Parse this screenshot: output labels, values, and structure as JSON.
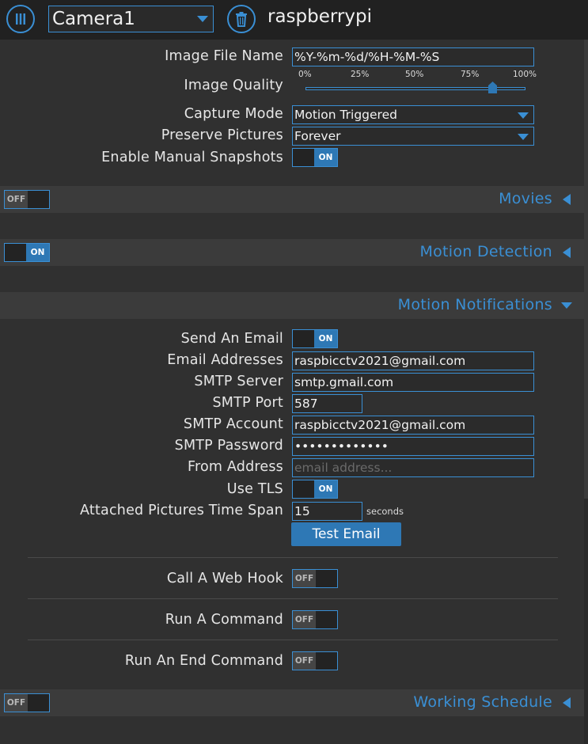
{
  "header": {
    "camera_select_value": "Camera1",
    "hostname": "raspberrypi",
    "menu_icon": "menu-bars-icon",
    "delete_icon": "trash-icon"
  },
  "still_images": {
    "image_file_name_label": "Image File Name",
    "image_file_name_value": "%Y-%m-%d/%H-%M-%S",
    "image_quality_label": "Image Quality",
    "image_quality_value_percent": 85,
    "slider_ticks": [
      "0%",
      "25%",
      "50%",
      "75%",
      "100%"
    ],
    "capture_mode_label": "Capture Mode",
    "capture_mode_value": "Motion Triggered",
    "preserve_pictures_label": "Preserve Pictures",
    "preserve_pictures_value": "Forever",
    "manual_snapshots_label": "Enable Manual Snapshots",
    "manual_snapshots_state": "ON"
  },
  "sections": {
    "movies": {
      "title": "Movies",
      "state": "OFF"
    },
    "motion_detection": {
      "title": "Motion Detection",
      "state": "ON"
    },
    "motion_notifications": {
      "title": "Motion Notifications"
    },
    "working_schedule": {
      "title": "Working Schedule",
      "state": "OFF"
    }
  },
  "notifications": {
    "send_email_label": "Send An Email",
    "send_email_state": "ON",
    "email_addresses_label": "Email Addresses",
    "email_addresses_value": "raspbicctv2021@gmail.com",
    "smtp_server_label": "SMTP Server",
    "smtp_server_value": "smtp.gmail.com",
    "smtp_port_label": "SMTP Port",
    "smtp_port_value": "587",
    "smtp_account_label": "SMTP Account",
    "smtp_account_value": "raspbicctv2021@gmail.com",
    "smtp_password_label": "SMTP Password",
    "smtp_password_value": "•••••••••••••",
    "from_address_label": "From Address",
    "from_address_placeholder": "email address...",
    "use_tls_label": "Use TLS",
    "use_tls_state": "ON",
    "time_span_label": "Attached Pictures Time Span",
    "time_span_value": "15",
    "time_span_unit": "seconds",
    "test_email_label": "Test Email",
    "web_hook_label": "Call A Web Hook",
    "web_hook_state": "OFF",
    "run_command_label": "Run A Command",
    "run_command_state": "OFF",
    "run_end_command_label": "Run An End Command",
    "run_end_command_state": "OFF"
  },
  "colors": {
    "accent": "#3a8fd4",
    "background": "#303030",
    "section_bar": "#3b3b3b",
    "topbar": "#212121"
  }
}
